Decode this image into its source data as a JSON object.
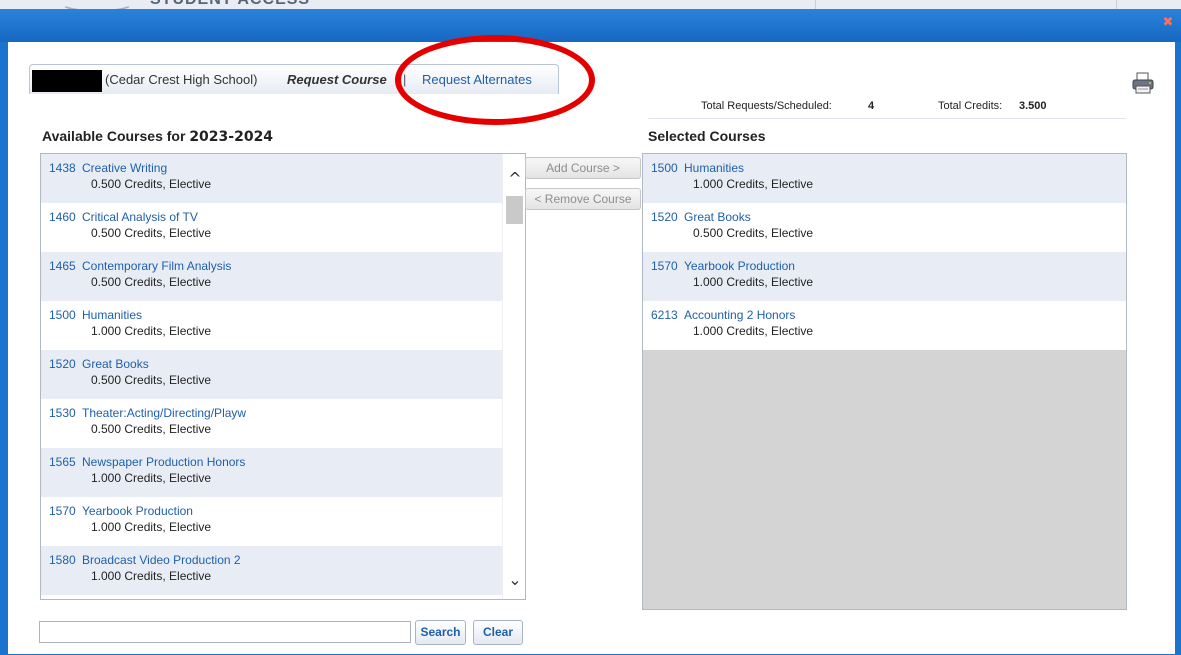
{
  "background": {
    "ghost_title": "STUDENT ACCESS"
  },
  "window": {
    "close_icon": "close-x-icon",
    "accent_color": "#1a73cf"
  },
  "tabs": {
    "context": "(Cedar Crest High School)",
    "active": "Request Course",
    "separator": "|",
    "alternates": "Request Alternates"
  },
  "totals": {
    "requests_label": "Total Requests/Scheduled:",
    "requests_value": "4",
    "credits_label": "Total Credits:",
    "credits_value": "3.500"
  },
  "available": {
    "header_prefix": "Available Courses for",
    "year": "2023-2024",
    "courses": [
      {
        "num": "1438",
        "name": "Creative Writing",
        "meta": "0.500 Credits,  Elective"
      },
      {
        "num": "1460",
        "name": "Critical Analysis of TV",
        "meta": "0.500 Credits,  Elective"
      },
      {
        "num": "1465",
        "name": "Contemporary Film Analysis",
        "meta": "0.500 Credits,  Elective"
      },
      {
        "num": "1500",
        "name": "Humanities",
        "meta": "1.000 Credits,  Elective"
      },
      {
        "num": "1520",
        "name": "Great Books",
        "meta": "0.500 Credits,  Elective"
      },
      {
        "num": "1530",
        "name": "Theater:Acting/Directing/Playw",
        "meta": "0.500 Credits,  Elective"
      },
      {
        "num": "1565",
        "name": "Newspaper Production Honors",
        "meta": "1.000 Credits,  Elective"
      },
      {
        "num": "1570",
        "name": "Yearbook Production",
        "meta": "1.000 Credits,  Elective"
      },
      {
        "num": "1580",
        "name": "Broadcast Video Production 2",
        "meta": "1.000 Credits,  Elective"
      }
    ]
  },
  "actions": {
    "add": "Add Course >",
    "remove": "< Remove Course"
  },
  "selected": {
    "header": "Selected Courses",
    "courses": [
      {
        "num": "1500",
        "name": "Humanities",
        "meta": "1.000 Credits,  Elective"
      },
      {
        "num": "1520",
        "name": "Great Books",
        "meta": "0.500 Credits,  Elective"
      },
      {
        "num": "1570",
        "name": "Yearbook Production",
        "meta": "1.000 Credits,  Elective"
      },
      {
        "num": "6213",
        "name": "Accounting 2 Honors",
        "meta": "1.000 Credits,  Elective"
      }
    ]
  },
  "search": {
    "value": "",
    "search_label": "Search",
    "clear_label": "Clear"
  },
  "icons": {
    "printer": "printer-icon",
    "scroll_up": "chevron-up-icon",
    "scroll_down": "chevron-down-icon"
  }
}
